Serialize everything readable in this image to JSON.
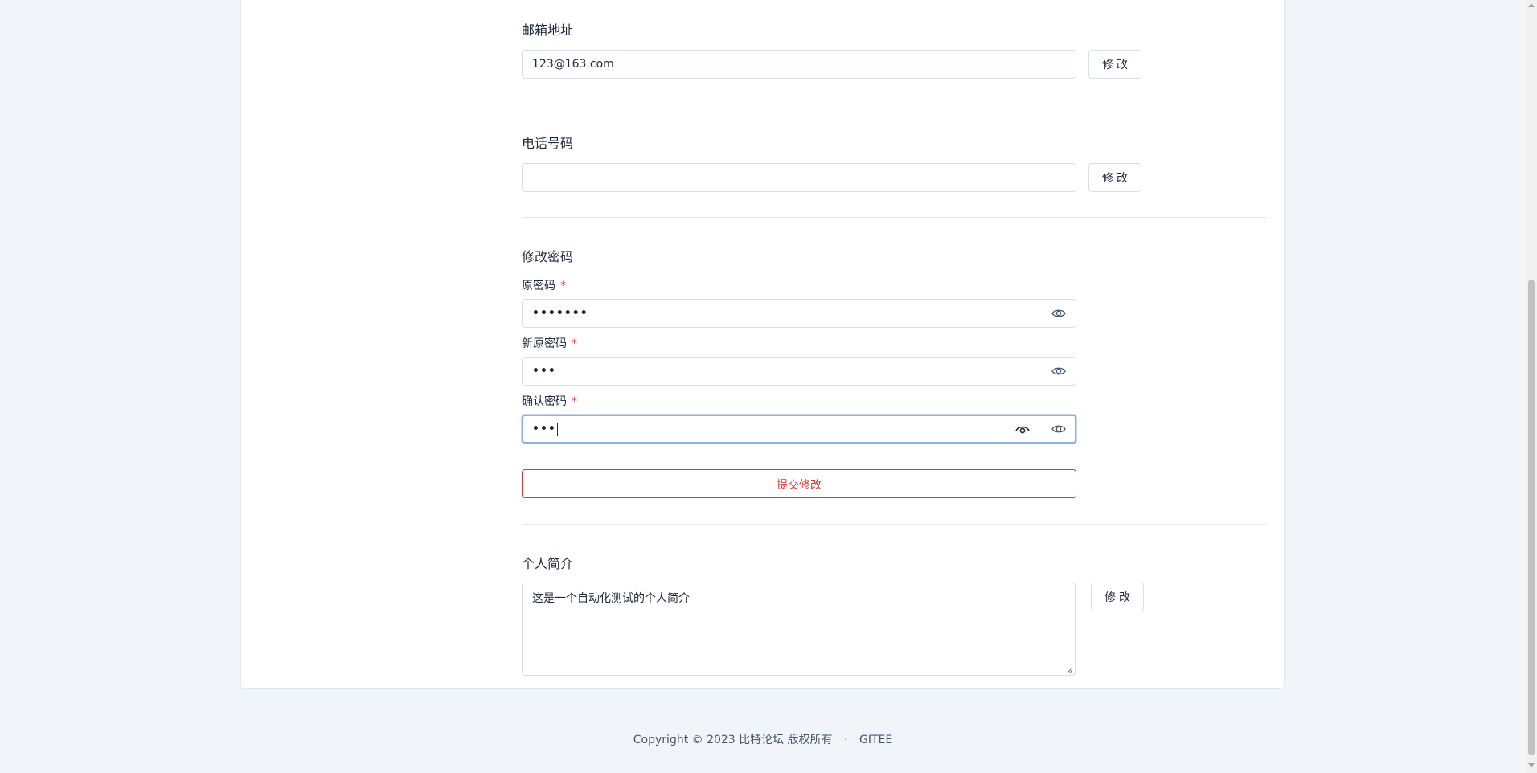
{
  "email": {
    "title": "邮箱地址",
    "value": "123@163.com",
    "button": "修改"
  },
  "phone": {
    "title": "电话号码",
    "value": "",
    "button": "修改"
  },
  "password": {
    "title": "修改密码",
    "old_label": "原密码",
    "new_label": "新原密码",
    "confirm_label": "确认密码",
    "required_mark": "*",
    "old_value_masked": "•••••••",
    "new_value_masked": "•••",
    "confirm_value_masked": "•••",
    "submit": "提交修改"
  },
  "bio": {
    "title": "个人简介",
    "value": "这是一个自动化测试的个人简介",
    "button": "修改"
  },
  "footer": {
    "copyright": "Copyright © 2023 比特论坛 版权所有",
    "separator": "·",
    "link": "GITEE"
  },
  "colors": {
    "accent_red": "#e03131",
    "focus_blue": "#8fb0e6",
    "background": "#f1f5f9"
  }
}
